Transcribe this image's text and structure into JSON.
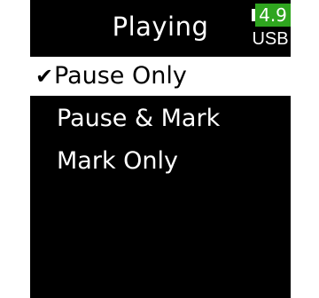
{
  "header": {
    "title": "Playing"
  },
  "status": {
    "battery_voltage": "4.9",
    "power_source": "USB",
    "battery_color": "#2fa51f"
  },
  "menu": {
    "items": [
      {
        "label": "Pause Only",
        "checked": true,
        "selected": true,
        "check_mark": "✔"
      },
      {
        "label": "Pause & Mark",
        "checked": false,
        "selected": false
      },
      {
        "label": "Mark Only",
        "checked": false,
        "selected": false
      }
    ]
  },
  "colors": {
    "background": "#000000",
    "text": "#ffffff",
    "highlight": "#ffffff",
    "highlight_text": "#000000"
  }
}
